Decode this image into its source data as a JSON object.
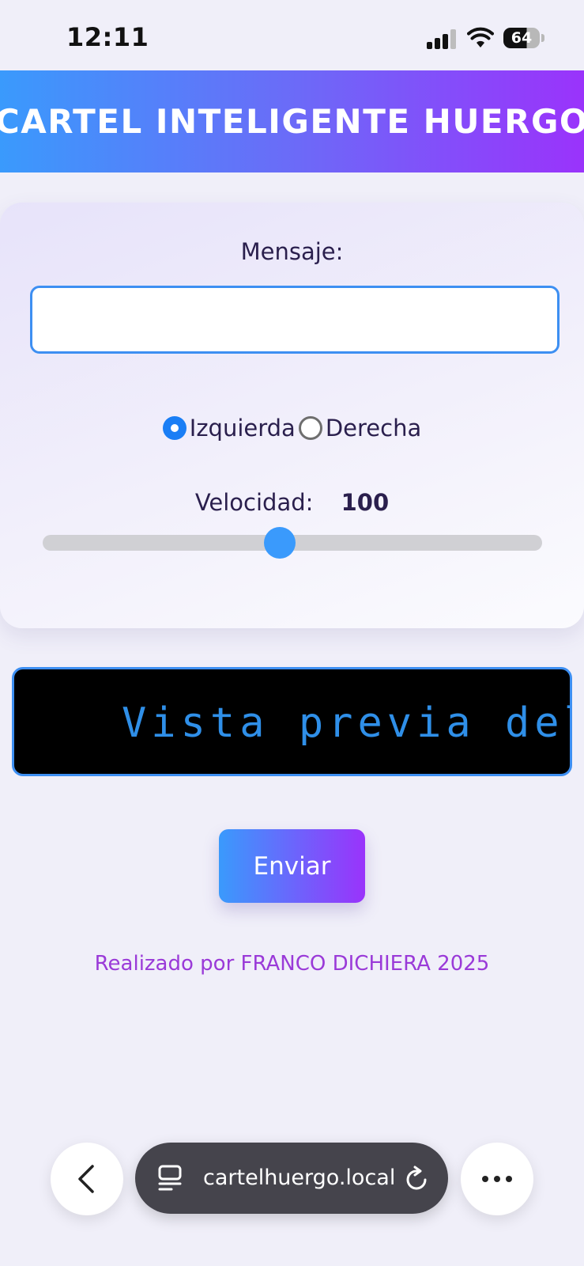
{
  "status_bar": {
    "time": "12:11",
    "battery": "64"
  },
  "header": {
    "title": "CARTEL INTELIGENTE HUERGO"
  },
  "form": {
    "message_label": "Mensaje:",
    "message_value": "",
    "direction_options": [
      {
        "label": "Izquierda",
        "checked": true
      },
      {
        "label": "Derecha",
        "checked": false
      }
    ],
    "speed_label": "Velocidad:",
    "speed_value": "100",
    "speed_fraction": 0.475
  },
  "preview": {
    "text": "Vista previa del mensaje"
  },
  "actions": {
    "send_label": "Enviar"
  },
  "footer": {
    "credit": "Realizado por FRANCO DICHIERA 2025"
  },
  "browser": {
    "url": "cartelhuergo.local",
    "icons": [
      "back-icon",
      "tabs-icon",
      "reload-icon",
      "more-icon"
    ]
  },
  "colors": {
    "accent_blue": "#3a9afc",
    "accent_purple": "#9a33fb",
    "preview_text": "#2f8fe8",
    "credit_text": "#9a3ad8"
  }
}
